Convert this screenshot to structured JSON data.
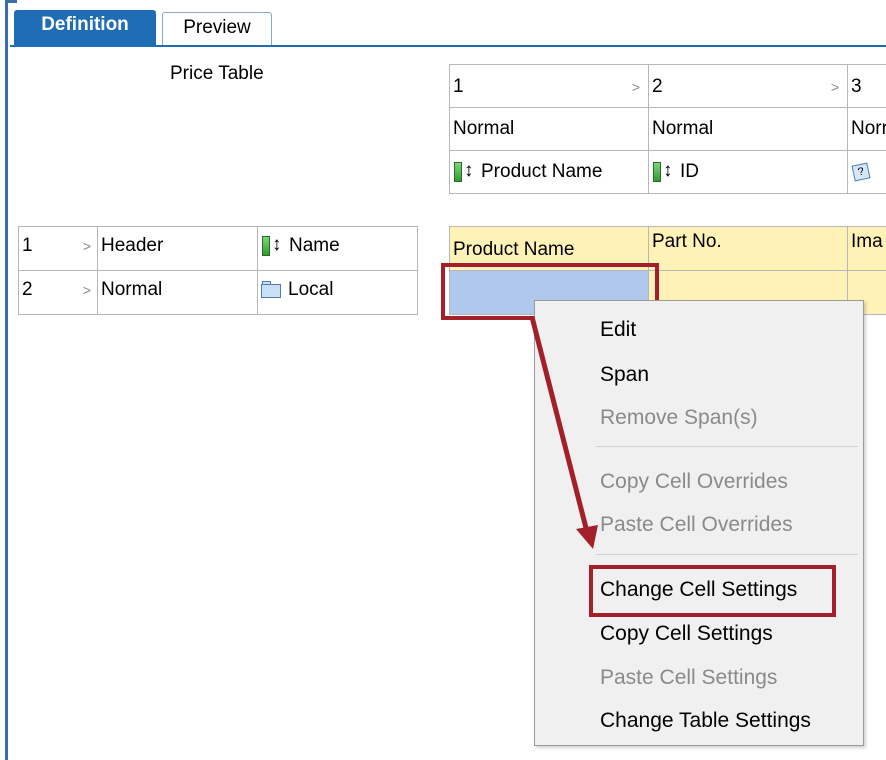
{
  "tabs": {
    "definition": "Definition",
    "preview": "Preview"
  },
  "table_title": "Price Table",
  "columns": [
    {
      "number": "1",
      "style": "Normal",
      "binding": "Product Name"
    },
    {
      "number": "2",
      "style": "Normal",
      "binding": "ID"
    },
    {
      "number": "3",
      "style": "Norr",
      "binding": ""
    }
  ],
  "row_defs": [
    {
      "number": "1",
      "style": "Header",
      "binding": "Name"
    },
    {
      "number": "2",
      "style": "Normal",
      "binding": "Local"
    }
  ],
  "header_cells": [
    "Product Name",
    "Part No.",
    "Ima"
  ],
  "context_menu": {
    "edit": "Edit",
    "span": "Span",
    "remove_spans": "Remove Span(s)",
    "copy_overrides": "Copy Cell Overrides",
    "paste_overrides": "Paste Cell Overrides",
    "change_cell_settings": "Change Cell Settings",
    "copy_cell_settings": "Copy Cell Settings",
    "paste_cell_settings": "Paste Cell Settings",
    "change_table_settings": "Change Table Settings"
  },
  "icons": {
    "field": "field-binding-icon",
    "folder": "folder-icon",
    "image": "image-field-icon",
    "chevron": "chevron-right-icon"
  },
  "colors": {
    "tab_active": "#1f6eb5",
    "highlight": "#a3202a",
    "header_fill": "#fff2b7",
    "selected_cell": "#b0c8ec"
  }
}
